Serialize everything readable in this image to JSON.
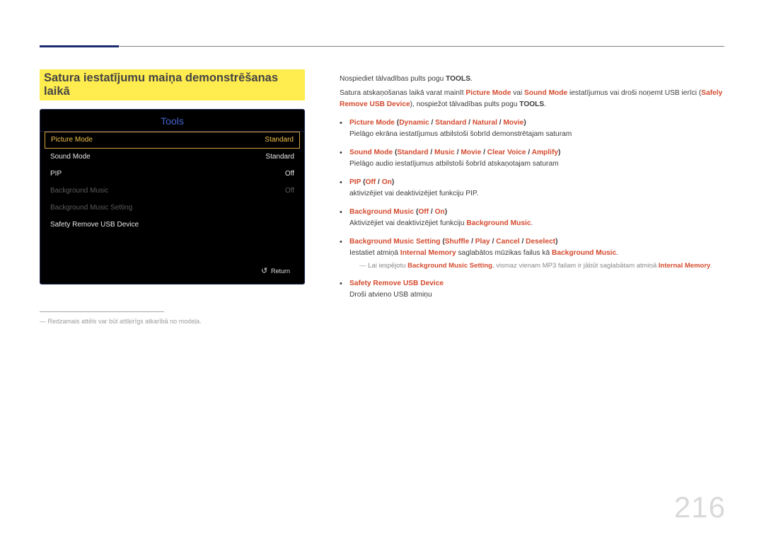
{
  "page_number": "216",
  "heading": "Satura iestatījumu maiņa demonstrēšanas laikā",
  "tools_panel": {
    "title": "Tools",
    "rows": [
      {
        "label": "Picture Mode",
        "value": "Standard",
        "state": "selected"
      },
      {
        "label": "Sound Mode",
        "value": "Standard",
        "state": "normal"
      },
      {
        "label": "PIP",
        "value": "Off",
        "state": "normal"
      },
      {
        "label": "Background Music",
        "value": "Off",
        "state": "dim"
      },
      {
        "label": "Background Music Setting",
        "value": "",
        "state": "dim"
      },
      {
        "label": "Safety Remove USB Device",
        "value": "",
        "state": "normal"
      }
    ],
    "return_label": "Return"
  },
  "left_footnote": "Redzamais attēls var būt atšķirīgs atkarībā no modeļa.",
  "intro": {
    "line1_a": "Nospiediet tālvadības pults pogu ",
    "line1_b": "TOOLS",
    "line1_c": ".",
    "line2_a": "Satura atskaņošanas laikā varat mainīt ",
    "line2_pm": "Picture Mode",
    "line2_mid": " vai ",
    "line2_sm": "Sound Mode",
    "line2_b": " iestatījumus vai droši noņemt USB ierīci (",
    "line2_sr": "Safely Remove USB Device",
    "line2_c": "), nospiežot tālvadības pults pogu ",
    "line2_tools": "TOOLS",
    "line2_end": "."
  },
  "bullets": {
    "pm": {
      "t1": "Picture Mode",
      "open": " (",
      "o1": "Dynamic",
      "s": " / ",
      "o2": "Standard",
      "o3": "Natural",
      "o4": "Movie",
      "close": ")",
      "desc": "Pielāgo ekrāna iestatījumus atbilstoši šobrīd demonstrētajam saturam"
    },
    "sm": {
      "t1": "Sound Mode",
      "open": " (",
      "o1": "Standard",
      "s": " / ",
      "o2": "Music",
      "o3": "Movie",
      "o4": "Clear Voice",
      "o5": "Amplify",
      "close": ")",
      "desc": "Pielāgo audio iestatījumus atbilstoši šobrīd atskaņotajam saturam"
    },
    "pip": {
      "t1": "PIP",
      "open": " (",
      "o1": "Off",
      "s": " / ",
      "o2": "On",
      "close": ")",
      "desc": "aktivizējiet vai deaktivizējiet funkciju PIP."
    },
    "bm": {
      "t1": "Background Music",
      "open": " (",
      "o1": "Off",
      "s": " / ",
      "o2": "On",
      "close": ")",
      "desc_a": "Aktivizējiet vai deaktivizējiet funkciju ",
      "desc_b": "Background Music",
      "desc_c": "."
    },
    "bms": {
      "t1": "Background Music Setting",
      "open": " (",
      "o1": "Shuffle",
      "s": " / ",
      "o2": "Play",
      "o3": "Cancel",
      "o4": "Deselect",
      "close": ")",
      "desc_a": "Iestatiet atmiņā ",
      "desc_im": "Internal Memory",
      "desc_b": " saglabātos mūzikas failus kā ",
      "desc_bm": "Background Music",
      "desc_c": "."
    },
    "note": {
      "a": "Lai iespējotu ",
      "b": "Background Music Setting",
      "c": ", vismaz vienam MP3 failam ir jābūt saglabātam atmiņā ",
      "d": "Internal Memory",
      "e": "."
    },
    "sr": {
      "t1": "Safety Remove USB Device",
      "desc": "Droši atvieno USB atmiņu"
    }
  }
}
